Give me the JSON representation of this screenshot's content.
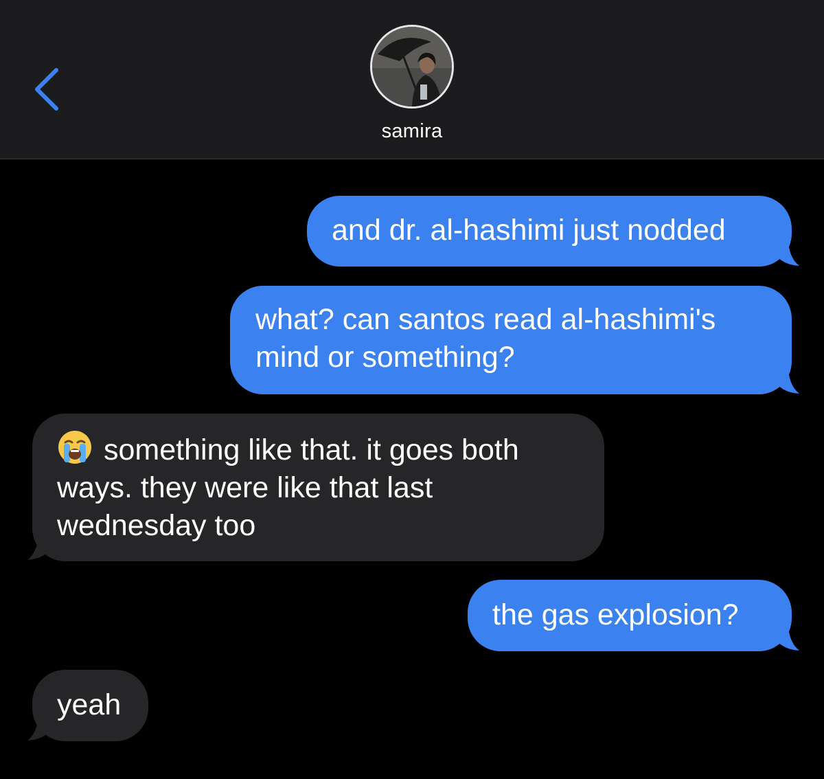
{
  "header": {
    "contact_name": "samira",
    "back_icon": "chevron-left-icon",
    "accent_color": "#3b82f0"
  },
  "messages": [
    {
      "direction": "sent",
      "text": "and dr. al-hashimi just nodded"
    },
    {
      "direction": "sent",
      "text": "what? can santos read al-hashimi's mind or something?"
    },
    {
      "direction": "received",
      "emoji": "loudly-crying-face-icon",
      "text": "something like that. it goes both ways. they were like that last wednesday too"
    },
    {
      "direction": "sent",
      "text": "the gas explosion?"
    },
    {
      "direction": "received",
      "text": "yeah"
    }
  ],
  "colors": {
    "sent_bubble": "#3b82f0",
    "received_bubble": "#262628",
    "background": "#000000",
    "header_background": "#1c1c1e"
  }
}
